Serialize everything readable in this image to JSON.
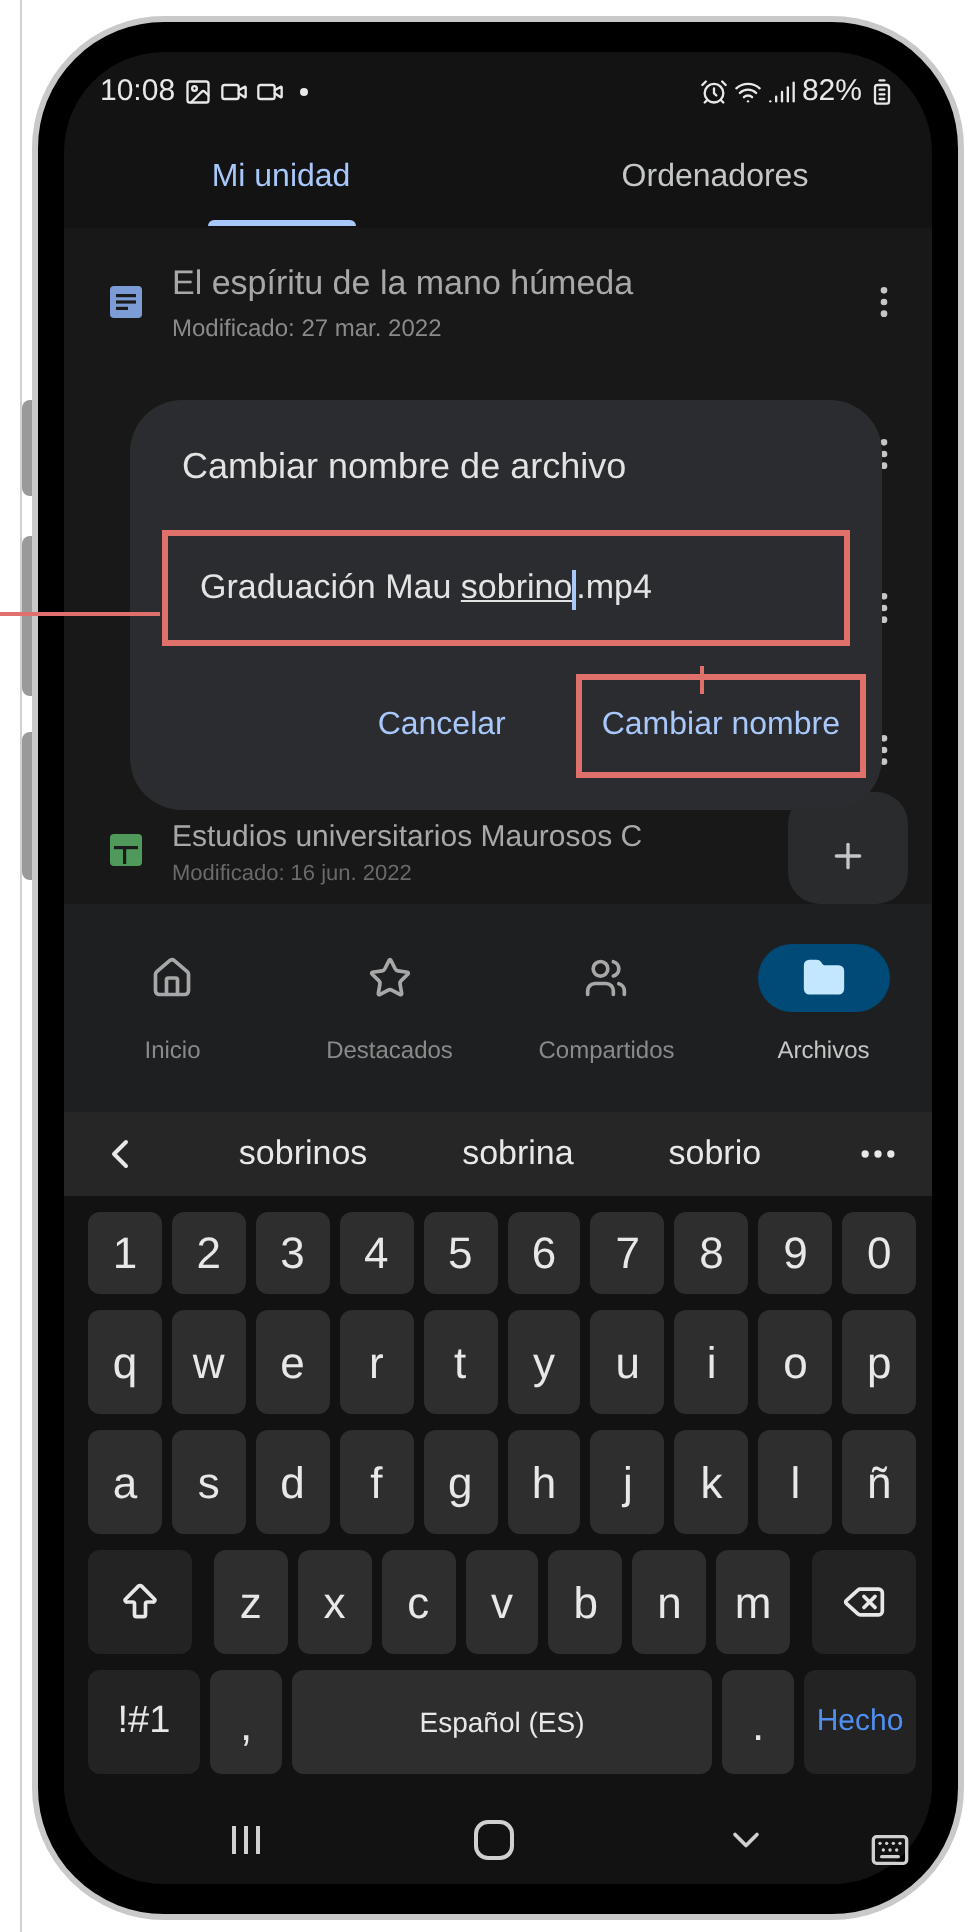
{
  "status_bar": {
    "time": "10:08",
    "battery": "82%"
  },
  "tabs": [
    {
      "label": "Mi unidad",
      "selected": true
    },
    {
      "label": "Ordenadores",
      "selected": false
    }
  ],
  "files": [
    {
      "name": "El espíritu de la mano húmeda",
      "modified": "Modificado: 27 mar. 2022",
      "kind": "doc"
    },
    {
      "name": "Estudios universitarios Maurosos C",
      "modified": "Modificado: 16 jun. 2022",
      "kind": "sheet"
    }
  ],
  "dialog": {
    "title": "Cambiar nombre de archivo",
    "field": {
      "text_before": "Graduación Mau ",
      "composing": "sobrino",
      "text_after": ".mp4",
      "highlighted": true
    },
    "buttons": [
      {
        "label": "Cancelar",
        "highlighted": false
      },
      {
        "label": "Cambiar nombre",
        "highlighted": true
      }
    ]
  },
  "bottom_nav": [
    {
      "label": "Inicio",
      "kind": "home",
      "selected": false
    },
    {
      "label": "Destacados",
      "kind": "star",
      "selected": false
    },
    {
      "label": "Compartidos",
      "kind": "people",
      "selected": false
    },
    {
      "label": "Archivos",
      "kind": "folder",
      "selected": true
    }
  ],
  "suggestions": [
    "sobrinos",
    "sobrina",
    "sobrio"
  ],
  "keyboard": [
    [
      {
        "kind": "num",
        "label": "1"
      },
      {
        "kind": "num",
        "label": "2"
      },
      {
        "kind": "num",
        "label": "3"
      },
      {
        "kind": "num",
        "label": "4"
      },
      {
        "kind": "num",
        "label": "5"
      },
      {
        "kind": "num",
        "label": "6"
      },
      {
        "kind": "num",
        "label": "7"
      },
      {
        "kind": "num",
        "label": "8"
      },
      {
        "kind": "num",
        "label": "9"
      },
      {
        "kind": "num",
        "label": "0"
      }
    ],
    [
      {
        "kind": "char",
        "label": "q"
      },
      {
        "kind": "char",
        "label": "w"
      },
      {
        "kind": "char",
        "label": "e"
      },
      {
        "kind": "char",
        "label": "r"
      },
      {
        "kind": "char",
        "label": "t"
      },
      {
        "kind": "char",
        "label": "y"
      },
      {
        "kind": "char",
        "label": "u"
      },
      {
        "kind": "char",
        "label": "i"
      },
      {
        "kind": "char",
        "label": "o"
      },
      {
        "kind": "char",
        "label": "p"
      }
    ],
    [
      {
        "kind": "char",
        "label": "a"
      },
      {
        "kind": "char",
        "label": "s"
      },
      {
        "kind": "char",
        "label": "d"
      },
      {
        "kind": "char",
        "label": "f"
      },
      {
        "kind": "char",
        "label": "g"
      },
      {
        "kind": "char",
        "label": "h"
      },
      {
        "kind": "char",
        "label": "j"
      },
      {
        "kind": "char",
        "label": "k"
      },
      {
        "kind": "char",
        "label": "l"
      },
      {
        "kind": "char",
        "label": "ñ"
      }
    ],
    [
      {
        "kind": "shift"
      },
      {
        "kind": "char",
        "label": "z"
      },
      {
        "kind": "char",
        "label": "x"
      },
      {
        "kind": "char",
        "label": "c"
      },
      {
        "kind": "char",
        "label": "v"
      },
      {
        "kind": "char",
        "label": "b"
      },
      {
        "kind": "char",
        "label": "n"
      },
      {
        "kind": "char",
        "label": "m"
      },
      {
        "kind": "backspace"
      }
    ],
    [
      {
        "kind": "symbols",
        "label": "!#1"
      },
      {
        "kind": "punct",
        "label": ","
      },
      {
        "kind": "space",
        "label": "Español (ES)"
      },
      {
        "kind": "punct",
        "label": "."
      },
      {
        "kind": "action",
        "label": "Hecho"
      }
    ]
  ]
}
